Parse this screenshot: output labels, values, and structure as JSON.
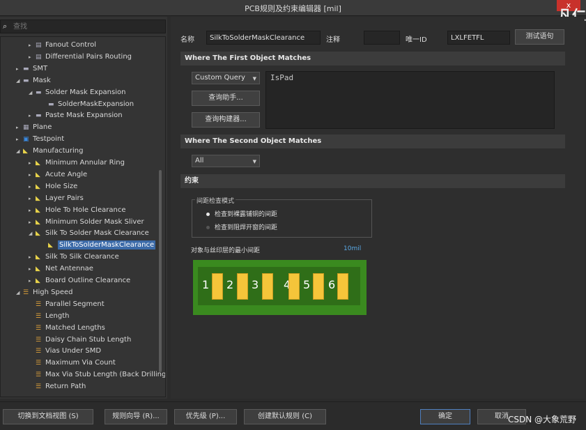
{
  "window": {
    "title": "PCB规则及约束编辑器 [mil]",
    "close": "x",
    "top_watermark": "凡仁"
  },
  "search": {
    "placeholder": "查找"
  },
  "tree": [
    {
      "label": "Fanout Control",
      "arrow": "▸",
      "icon": "▤",
      "type": "grp"
    },
    {
      "label": "Differential Pairs Routing",
      "arrow": "▸",
      "icon": "▤",
      "type": "grp"
    },
    {
      "label": "SMT",
      "arrow": "▸",
      "icon": "▬",
      "type": "grp"
    },
    {
      "label": "Mask",
      "arrow": "◢",
      "icon": "▬",
      "type": "grp"
    },
    {
      "label": "Solder Mask Expansion",
      "arrow": "◢",
      "icon": "▬",
      "type": "grp"
    },
    {
      "label": "SolderMaskExpansion",
      "arrow": "",
      "icon": "▬",
      "type": "grp"
    },
    {
      "label": "Paste Mask Expansion",
      "arrow": "▸",
      "icon": "▬",
      "type": "grp"
    },
    {
      "label": "Plane",
      "arrow": "▸",
      "icon": "▦",
      "type": "grp"
    },
    {
      "label": "Testpoint",
      "arrow": "▸",
      "icon": "▣",
      "type": "tp"
    },
    {
      "label": "Manufacturing",
      "arrow": "◢",
      "icon": "◣",
      "type": "rule"
    },
    {
      "label": "Minimum Annular Ring",
      "arrow": "▸",
      "icon": "◣",
      "type": "rule"
    },
    {
      "label": "Acute Angle",
      "arrow": "▸",
      "icon": "◣",
      "type": "rule"
    },
    {
      "label": "Hole Size",
      "arrow": "▸",
      "icon": "◣",
      "type": "rule"
    },
    {
      "label": "Layer Pairs",
      "arrow": "▸",
      "icon": "◣",
      "type": "rule"
    },
    {
      "label": "Hole To Hole Clearance",
      "arrow": "▸",
      "icon": "◣",
      "type": "rule"
    },
    {
      "label": "Minimum Solder Mask Sliver",
      "arrow": "▸",
      "icon": "◣",
      "type": "rule"
    },
    {
      "label": "Silk To Solder Mask Clearance",
      "arrow": "◢",
      "icon": "◣",
      "type": "rule"
    },
    {
      "label": "SilkToSolderMaskClearance",
      "arrow": "",
      "icon": "◣",
      "type": "rule",
      "selected": true
    },
    {
      "label": "Silk To Silk Clearance",
      "arrow": "▸",
      "icon": "◣",
      "type": "rule"
    },
    {
      "label": "Net Antennae",
      "arrow": "▸",
      "icon": "◣",
      "type": "rule"
    },
    {
      "label": "Board Outline Clearance",
      "arrow": "▸",
      "icon": "◣",
      "type": "rule"
    },
    {
      "label": "High Speed",
      "arrow": "◢",
      "icon": "☰",
      "type": "hs"
    },
    {
      "label": "Parallel Segment",
      "arrow": "",
      "icon": "☰",
      "type": "hs"
    },
    {
      "label": "Length",
      "arrow": "",
      "icon": "☰",
      "type": "hs"
    },
    {
      "label": "Matched Lengths",
      "arrow": "",
      "icon": "☰",
      "type": "hs"
    },
    {
      "label": "Daisy Chain Stub Length",
      "arrow": "",
      "icon": "☰",
      "type": "hs"
    },
    {
      "label": "Vias Under SMD",
      "arrow": "",
      "icon": "☰",
      "type": "hs"
    },
    {
      "label": "Maximum Via Count",
      "arrow": "",
      "icon": "☰",
      "type": "hs"
    },
    {
      "label": "Max Via Stub Length (Back Drilling)",
      "arrow": "",
      "icon": "☰",
      "type": "hs"
    },
    {
      "label": "Return Path",
      "arrow": "",
      "icon": "☰",
      "type": "hs"
    }
  ],
  "header": {
    "name_label": "名称",
    "name_value": "SilkToSolderMaskClearance",
    "comment_label": "注释",
    "comment_value": "",
    "uid_label": "唯一ID",
    "uid_value": "LXLFETFL",
    "test_button": "测试语句"
  },
  "first_match": {
    "title": "Where The First Object Matches",
    "query_type": "Custom Query",
    "helper_button": "查询助手...",
    "builder_button": "查询构建器...",
    "query": "IsPad"
  },
  "second_match": {
    "title": "Where The Second Object Matches",
    "scope": "All"
  },
  "constraints": {
    "title": "约束",
    "mode_group": "间距检查模式",
    "option1": "检查到裸露铺铜的间距",
    "option2": "检查到阻焊开窗的间距",
    "min_gap_label": "对象与丝印层的最小间距",
    "min_gap_value": "10mil",
    "pads": [
      "1",
      "2",
      "3",
      "4",
      "5",
      "6"
    ]
  },
  "footer": {
    "doc_view": "切换到文档视图 (S)",
    "wizard": "规则向导 (R)...",
    "priority": "优先级 (P)...",
    "create_default": "创建默认规则 (C)",
    "ok": "确定",
    "cancel": "取消",
    "watermark": "CSDN @大象荒野"
  },
  "colors": {
    "selection": "#3b6aa8",
    "pcb_green": "#3a8a1f",
    "pad": "#f5c53a",
    "close": "#c8312b"
  }
}
